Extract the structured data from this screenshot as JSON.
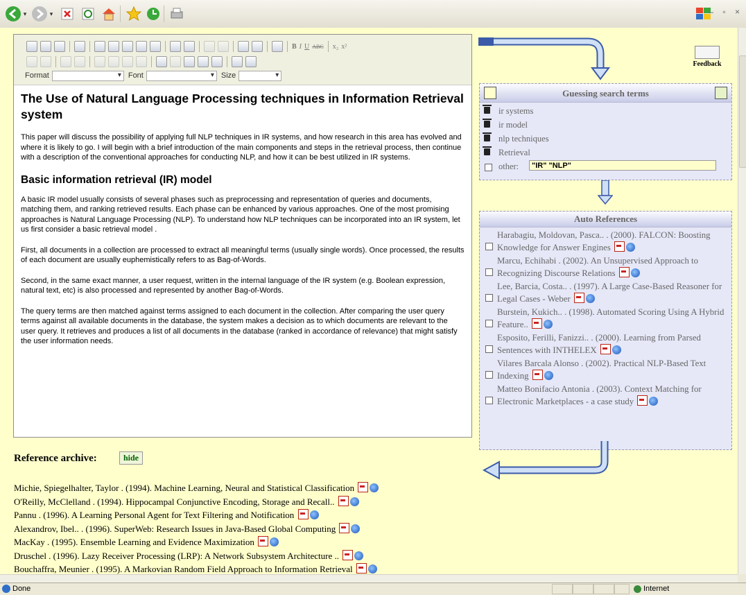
{
  "browser": {
    "status_text": "Done",
    "zone_text": "Internet"
  },
  "editor": {
    "format_label": "Format",
    "font_label": "Font",
    "size_label": "Size",
    "title": "The Use of Natural Language Processing techniques in Information Retrieval system",
    "intro": "This paper will discuss the possibility of applying full NLP techniques in IR systems, and how research in this area has evolved and where it is likely to go. I will begin with a brief introduction of the main components and steps in the retrieval process, then continue with a description of the conventional approaches for conducting NLP, and how it can be best utilized in IR systems.",
    "section_heading": "Basic information retrieval (IR) model",
    "paragraphs": [
      "A basic IR model usually consists of several phases such as preprocessing and representation of queries and documents, matching them, and ranking retrieved results. Each phase can be enhanced by various approaches. One of the most promising approaches is Natural Language Processing (NLP). To understand how NLP techniques can be incorporated into an IR system, let us first consider a basic retrieval model .",
      "First, all documents in a collection are processed to extract all meaningful terms (usually single words). Once processed, the results of each document are usually euphemistically refers to as Bag-of-Words.",
      "Second, in the same exact manner, a user request, written in the internal language of the IR system (e.g. Boolean expression, natural text, etc) is also processed and represented by another Bag-of-Words.",
      "The query terms are then matched against terms assigned to each document in the collection. After comparing the user query terms against all available documents in the database, the system makes a decision as to which documents are relevant to the user query. It retrieves and produces a list of all documents in the database (ranked in accordance of relevance) that might satisfy the user information needs."
    ]
  },
  "feedback": {
    "label": "Feedback"
  },
  "guess_panel": {
    "title": "Guessing search terms",
    "terms": [
      "ir systems",
      "ir model",
      "nlp techniques",
      "Retrieval"
    ],
    "other_label": "other:",
    "other_value": "\"IR\" \"NLP\""
  },
  "auto_refs": {
    "title": "Auto References",
    "items": [
      "Harabagiu, Moldovan, Pasca.. . (2000). FALCON: Boosting Knowledge for Answer Engines",
      "Marcu, Echihabi . (2002). An Unsupervised Approach to Recognizing Discourse Relations",
      "Lee, Barcia, Costa.. . (1997). A Large Case-Based Reasoner for Legal Cases - Weber",
      "Burstein, Kukich.. . (1998). Automated Scoring Using A Hybrid Feature..",
      "Esposito, Ferilli, Fanizzi.. . (2000). Learning from Parsed Sentences with INTHELEX",
      "Vilares Barcala Alonso . (2002). Practical NLP-Based Text Indexing",
      "Matteo Bonifacio Antonia . (2003). Context Matching for Electronic Marketplaces - a case study"
    ]
  },
  "archive": {
    "title": "Reference archive:",
    "hide_label": "hide",
    "items": [
      "Michie, Spiegelhalter, Taylor . (1994). Machine Learning, Neural and Statistical Classification",
      "O'Reilly, McClelland . (1994). Hippocampal Conjunctive Encoding, Storage and Recall..",
      "Pannu . (1996). A Learning Personal Agent for Text Filtering and Notification",
      "Alexandrov, Ibel.. . (1996). SuperWeb: Research Issues in Java-Based Global Computing",
      "MacKay . (1995). Ensemble Learning and Evidence Maximization",
      "Druschel . (1996). Lazy Receiver Processing (LRP): A Network Subsystem Architecture ..",
      "Bouchaffra, Meunier . (1995). A Markovian Random Field Approach to Information Retrieval"
    ]
  }
}
